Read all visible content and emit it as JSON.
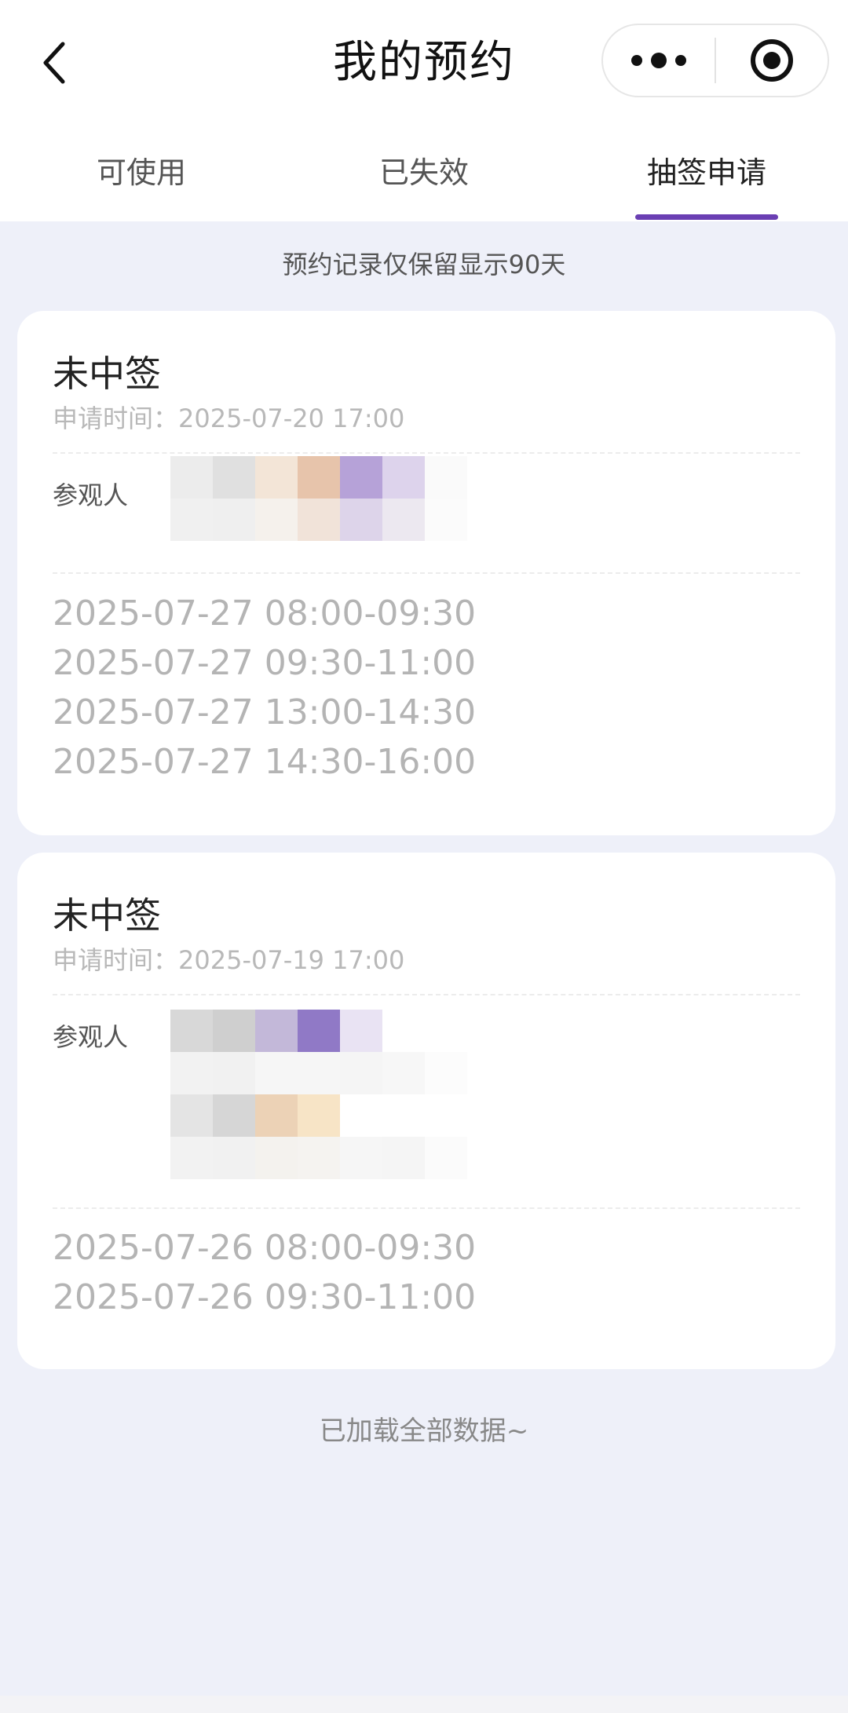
{
  "header": {
    "title": "我的预约",
    "back_icon": "chevron-left-icon",
    "more_icon": "more-dots-icon",
    "close_icon": "target-circle-icon"
  },
  "tabs": [
    {
      "label": "可使用",
      "active": false
    },
    {
      "label": "已失效",
      "active": false
    },
    {
      "label": "抽签申请",
      "active": true
    }
  ],
  "notice": "预约记录仅保留显示90天",
  "cards": [
    {
      "status": "未中签",
      "apply_time": "申请时间：2025-07-20 17:00",
      "visitor_label": "参观人",
      "slots": [
        "2025-07-27 08:00-09:30",
        "2025-07-27 09:30-11:00",
        "2025-07-27 13:00-14:30",
        "2025-07-27 14:30-16:00"
      ]
    },
    {
      "status": "未中签",
      "apply_time": "申请时间：2025-07-19 17:00",
      "visitor_label": "参观人",
      "slots": [
        "2025-07-26 08:00-09:30",
        "2025-07-26 09:30-11:00"
      ]
    }
  ],
  "footer": "已加载全部数据~",
  "colors": {
    "accent": "#6a3fb3",
    "background": "#eef0f9"
  }
}
